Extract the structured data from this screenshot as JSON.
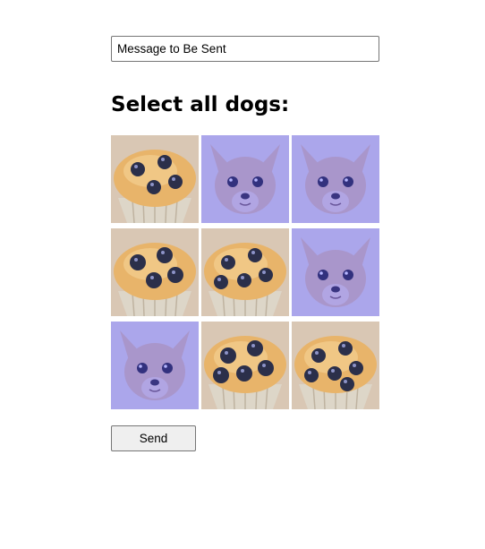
{
  "form": {
    "message_placeholder": "Message to Be Sent",
    "title": "Select all dogs:",
    "send_label": "Send"
  },
  "grid": {
    "tiles": [
      {
        "kind": "muffin",
        "selected": false
      },
      {
        "kind": "dog",
        "selected": true
      },
      {
        "kind": "dog",
        "selected": true
      },
      {
        "kind": "muffin",
        "selected": false
      },
      {
        "kind": "muffin",
        "selected": false
      },
      {
        "kind": "dog",
        "selected": true
      },
      {
        "kind": "dog",
        "selected": true
      },
      {
        "kind": "muffin",
        "selected": false
      },
      {
        "kind": "muffin",
        "selected": false
      }
    ]
  },
  "colors": {
    "selection_overlay": "#5050ff",
    "muffin_top": "#e8b46a",
    "blueberry": "#2b2f4a",
    "dog_fur": "#e9c8a6"
  }
}
